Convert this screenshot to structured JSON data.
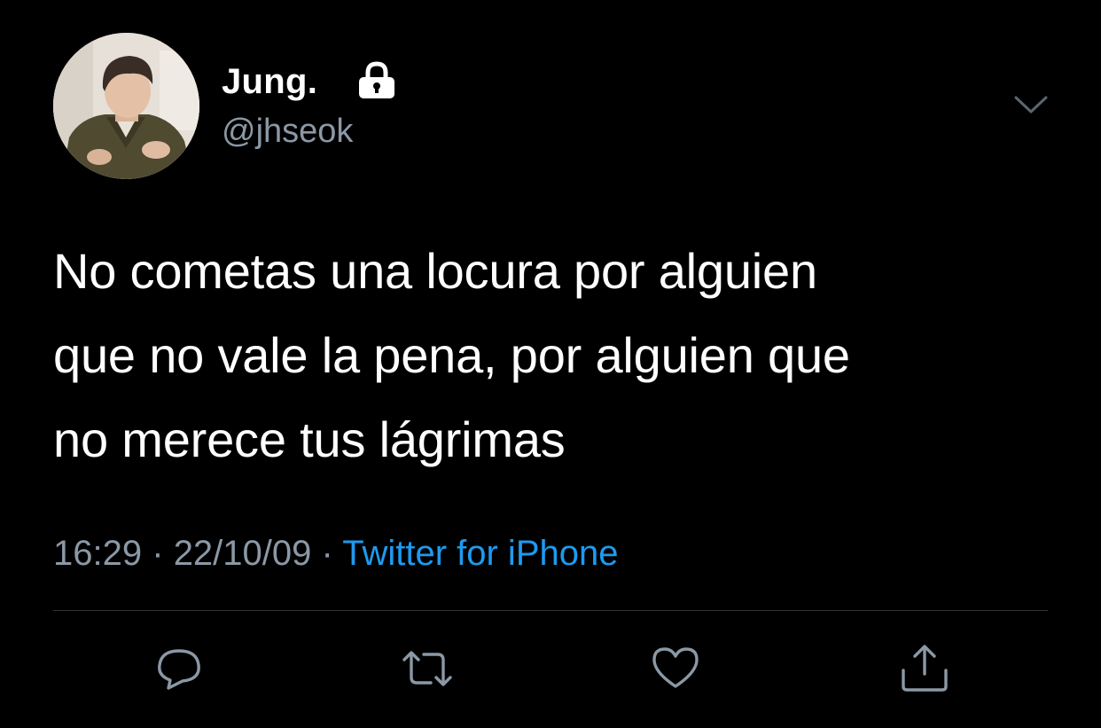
{
  "tweet": {
    "display_name": "Jung.",
    "handle": "@jhseok",
    "protected_icon": "lock-icon",
    "more_icon": "chevron-down-icon",
    "text_lines": [
      "No cometas una locura por alguien",
      "que no vale la pena, por alguien que",
      "no merece tus lágrimas"
    ],
    "time": "16:29",
    "date": "22/10/09",
    "separator": "·",
    "source": "Twitter for iPhone"
  },
  "actions": {
    "reply_icon": "reply-icon",
    "retweet_icon": "retweet-icon",
    "like_icon": "heart-icon",
    "share_icon": "share-icon"
  },
  "colors": {
    "background": "#000000",
    "primary_text": "#ffffff",
    "secondary_text": "#8b98a5",
    "link": "#1d9bf0",
    "divider": "#2f3336"
  }
}
